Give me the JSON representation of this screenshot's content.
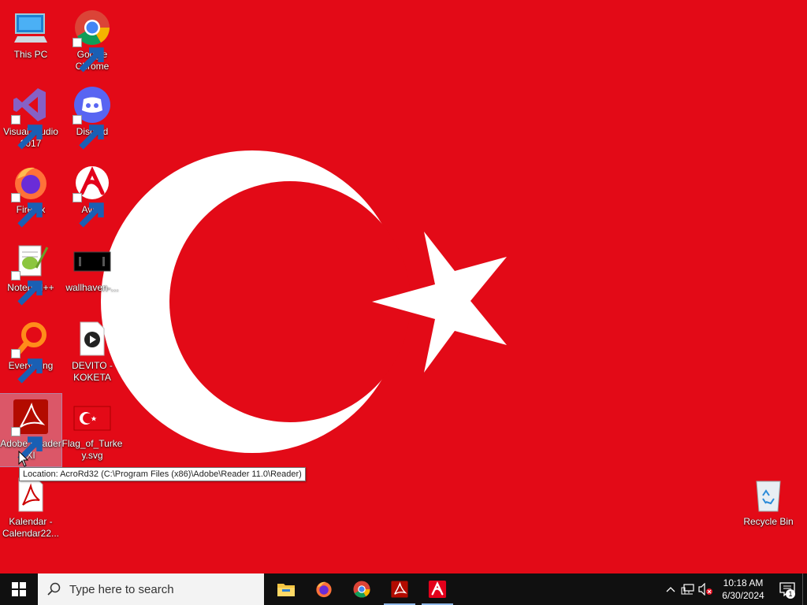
{
  "desktop": {
    "wallpaper_colors": {
      "red": "#e30a17",
      "white": "#ffffff"
    },
    "icons": [
      {
        "label": "This PC",
        "icon": "monitor-icon"
      },
      {
        "label": "Google Chrome",
        "icon": "chrome-icon"
      },
      {
        "label": "Visual Studio 2017",
        "icon": "visual-studio-icon"
      },
      {
        "label": "Discord",
        "icon": "discord-icon"
      },
      {
        "label": "Firefox",
        "icon": "firefox-icon"
      },
      {
        "label": "Avira",
        "icon": "avira-icon"
      },
      {
        "label": "Notepad++",
        "icon": "notepadpp-icon"
      },
      {
        "label": "wallhaven-...",
        "icon": "image-file-icon"
      },
      {
        "label": "Everything",
        "icon": "everything-icon"
      },
      {
        "label": "DEVITO - KOKETA",
        "icon": "media-file-icon"
      },
      {
        "label": "Adobe Reader XI",
        "icon": "adobe-reader-icon"
      },
      {
        "label": "Flag_of_Turkey.svg",
        "icon": "svg-file-icon"
      },
      {
        "label": "Kalendar - Calendar22...",
        "icon": "pdf-file-icon"
      },
      {
        "label": "Recycle Bin",
        "icon": "recycle-bin-icon"
      }
    ],
    "tooltip": "Location: AcroRd32 (C:\\Program Files (x86)\\Adobe\\Reader 11.0\\Reader)"
  },
  "taskbar": {
    "search_placeholder": "Type here to search",
    "pinned": [
      "file-explorer-icon",
      "firefox-icon",
      "chrome-icon",
      "adobe-reader-icon",
      "avira-icon"
    ],
    "clock": {
      "time": "10:18 AM",
      "date": "6/30/2024"
    },
    "notification_count": "1"
  }
}
